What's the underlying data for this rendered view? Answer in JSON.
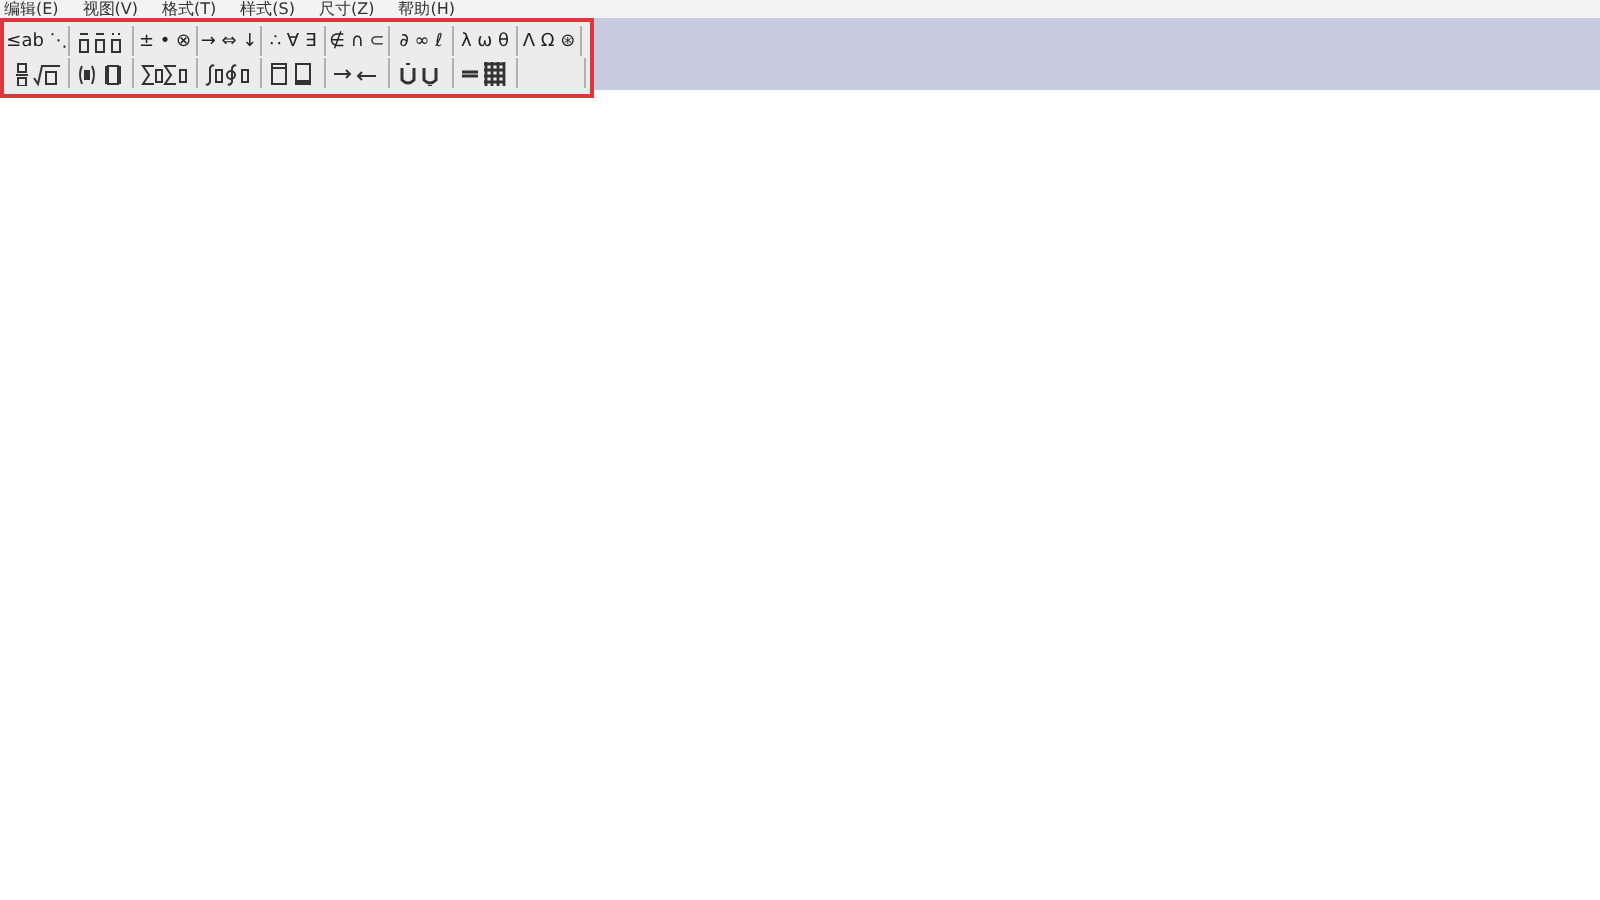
{
  "menu_bar": {
    "items": [
      {
        "label": "编辑(E)"
      },
      {
        "label": "视图(V)"
      },
      {
        "label": "格式(T)"
      },
      {
        "label": "样式(S)"
      },
      {
        "label": "尺寸(Z)"
      },
      {
        "label": "帮助(H)"
      }
    ]
  },
  "palette": {
    "highlighted": true,
    "rows": [
      [
        {
          "kind": "symbols",
          "text": "≤ab ⋱"
        },
        {
          "kind": "template"
        },
        {
          "kind": "symbols",
          "text": "± • ⊗"
        },
        {
          "kind": "symbols",
          "text": "→ ⇔ ↓"
        },
        {
          "kind": "symbols",
          "text": "∴ ∀ ∃"
        },
        {
          "kind": "symbols",
          "text": "∉ ∩ ⊂"
        },
        {
          "kind": "symbols",
          "text": "∂ ∞ ℓ"
        },
        {
          "kind": "symbols",
          "text": "λ ω θ"
        },
        {
          "kind": "symbols",
          "text": "Λ Ω ⊛"
        }
      ],
      [
        {
          "kind": "template"
        },
        {
          "kind": "template"
        },
        {
          "kind": "template"
        },
        {
          "kind": "template"
        },
        {
          "kind": "template"
        },
        {
          "kind": "template"
        },
        {
          "kind": "template"
        },
        {
          "kind": "template"
        },
        {
          "kind": "blank"
        }
      ]
    ]
  }
}
